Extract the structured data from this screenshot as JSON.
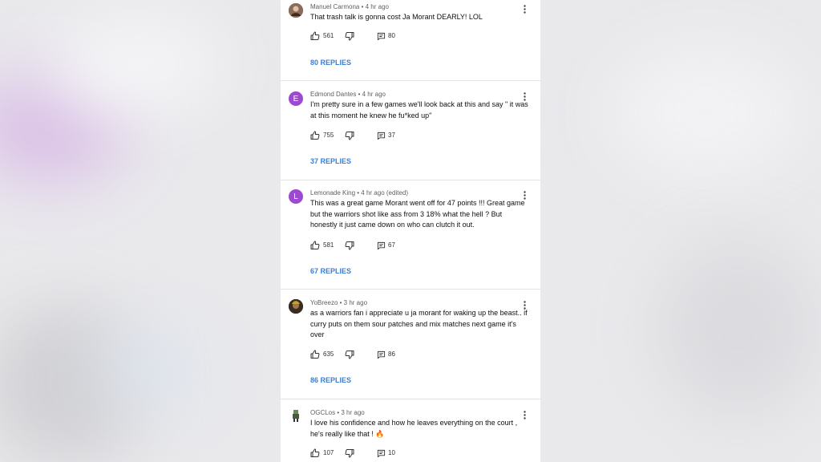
{
  "comments": [
    {
      "author": "Manuel Carmona",
      "time": "4 hr ago",
      "edited": "",
      "avatar_letter": "",
      "avatar_color": "#7a5a48",
      "text": "That trash talk is gonna cost Ja Morant DEARLY! LOL",
      "likes": "561",
      "replies": "80",
      "replies_label": "80 REPLIES"
    },
    {
      "author": "Edmond Dantes",
      "time": "4 hr ago",
      "edited": "",
      "avatar_letter": "E",
      "avatar_color": "#9c4bd0",
      "text": "I'm pretty sure in a few games we'll look back at this and say \" it was at this moment he knew he fu*ked up\"",
      "likes": "755",
      "replies": "37",
      "replies_label": "37 REPLIES"
    },
    {
      "author": "Lemonade King",
      "time": "4 hr ago",
      "edited": "(edited)",
      "avatar_letter": "L",
      "avatar_color": "#9c4bd0",
      "text": "This was a great game Morant went off for 47 points !!! Great game but the warriors shot like ass from 3 18% what the hell ? But honestly it just came down on who can clutch it out.",
      "likes": "581",
      "replies": "67",
      "replies_label": "67 REPLIES"
    },
    {
      "author": "YoBreezo",
      "time": "3 hr ago",
      "edited": "",
      "avatar_letter": "",
      "avatar_color": "#4a3a2c",
      "text": "as a warriors fan i appreciate u ja morant for waking up the beast.. if curry puts on them sour patches and mix matches next game it's over",
      "likes": "635",
      "replies": "86",
      "replies_label": "86 REPLIES"
    },
    {
      "author": "OGCLos",
      "time": "3 hr ago",
      "edited": "",
      "avatar_letter": "",
      "avatar_color": "#6a7a5a",
      "text": "I love his confidence and how he leaves everything on the court , he's really like that ! 🔥",
      "likes": "107",
      "replies": "10",
      "replies_label": ""
    }
  ],
  "icons": {
    "like": "thumbs-up-icon",
    "dislike": "thumbs-down-icon",
    "reply": "comment-icon",
    "menu": "more-vert-icon"
  },
  "colors": {
    "link": "#3a7fd5",
    "avatar_purple": "#9c4bd0"
  }
}
